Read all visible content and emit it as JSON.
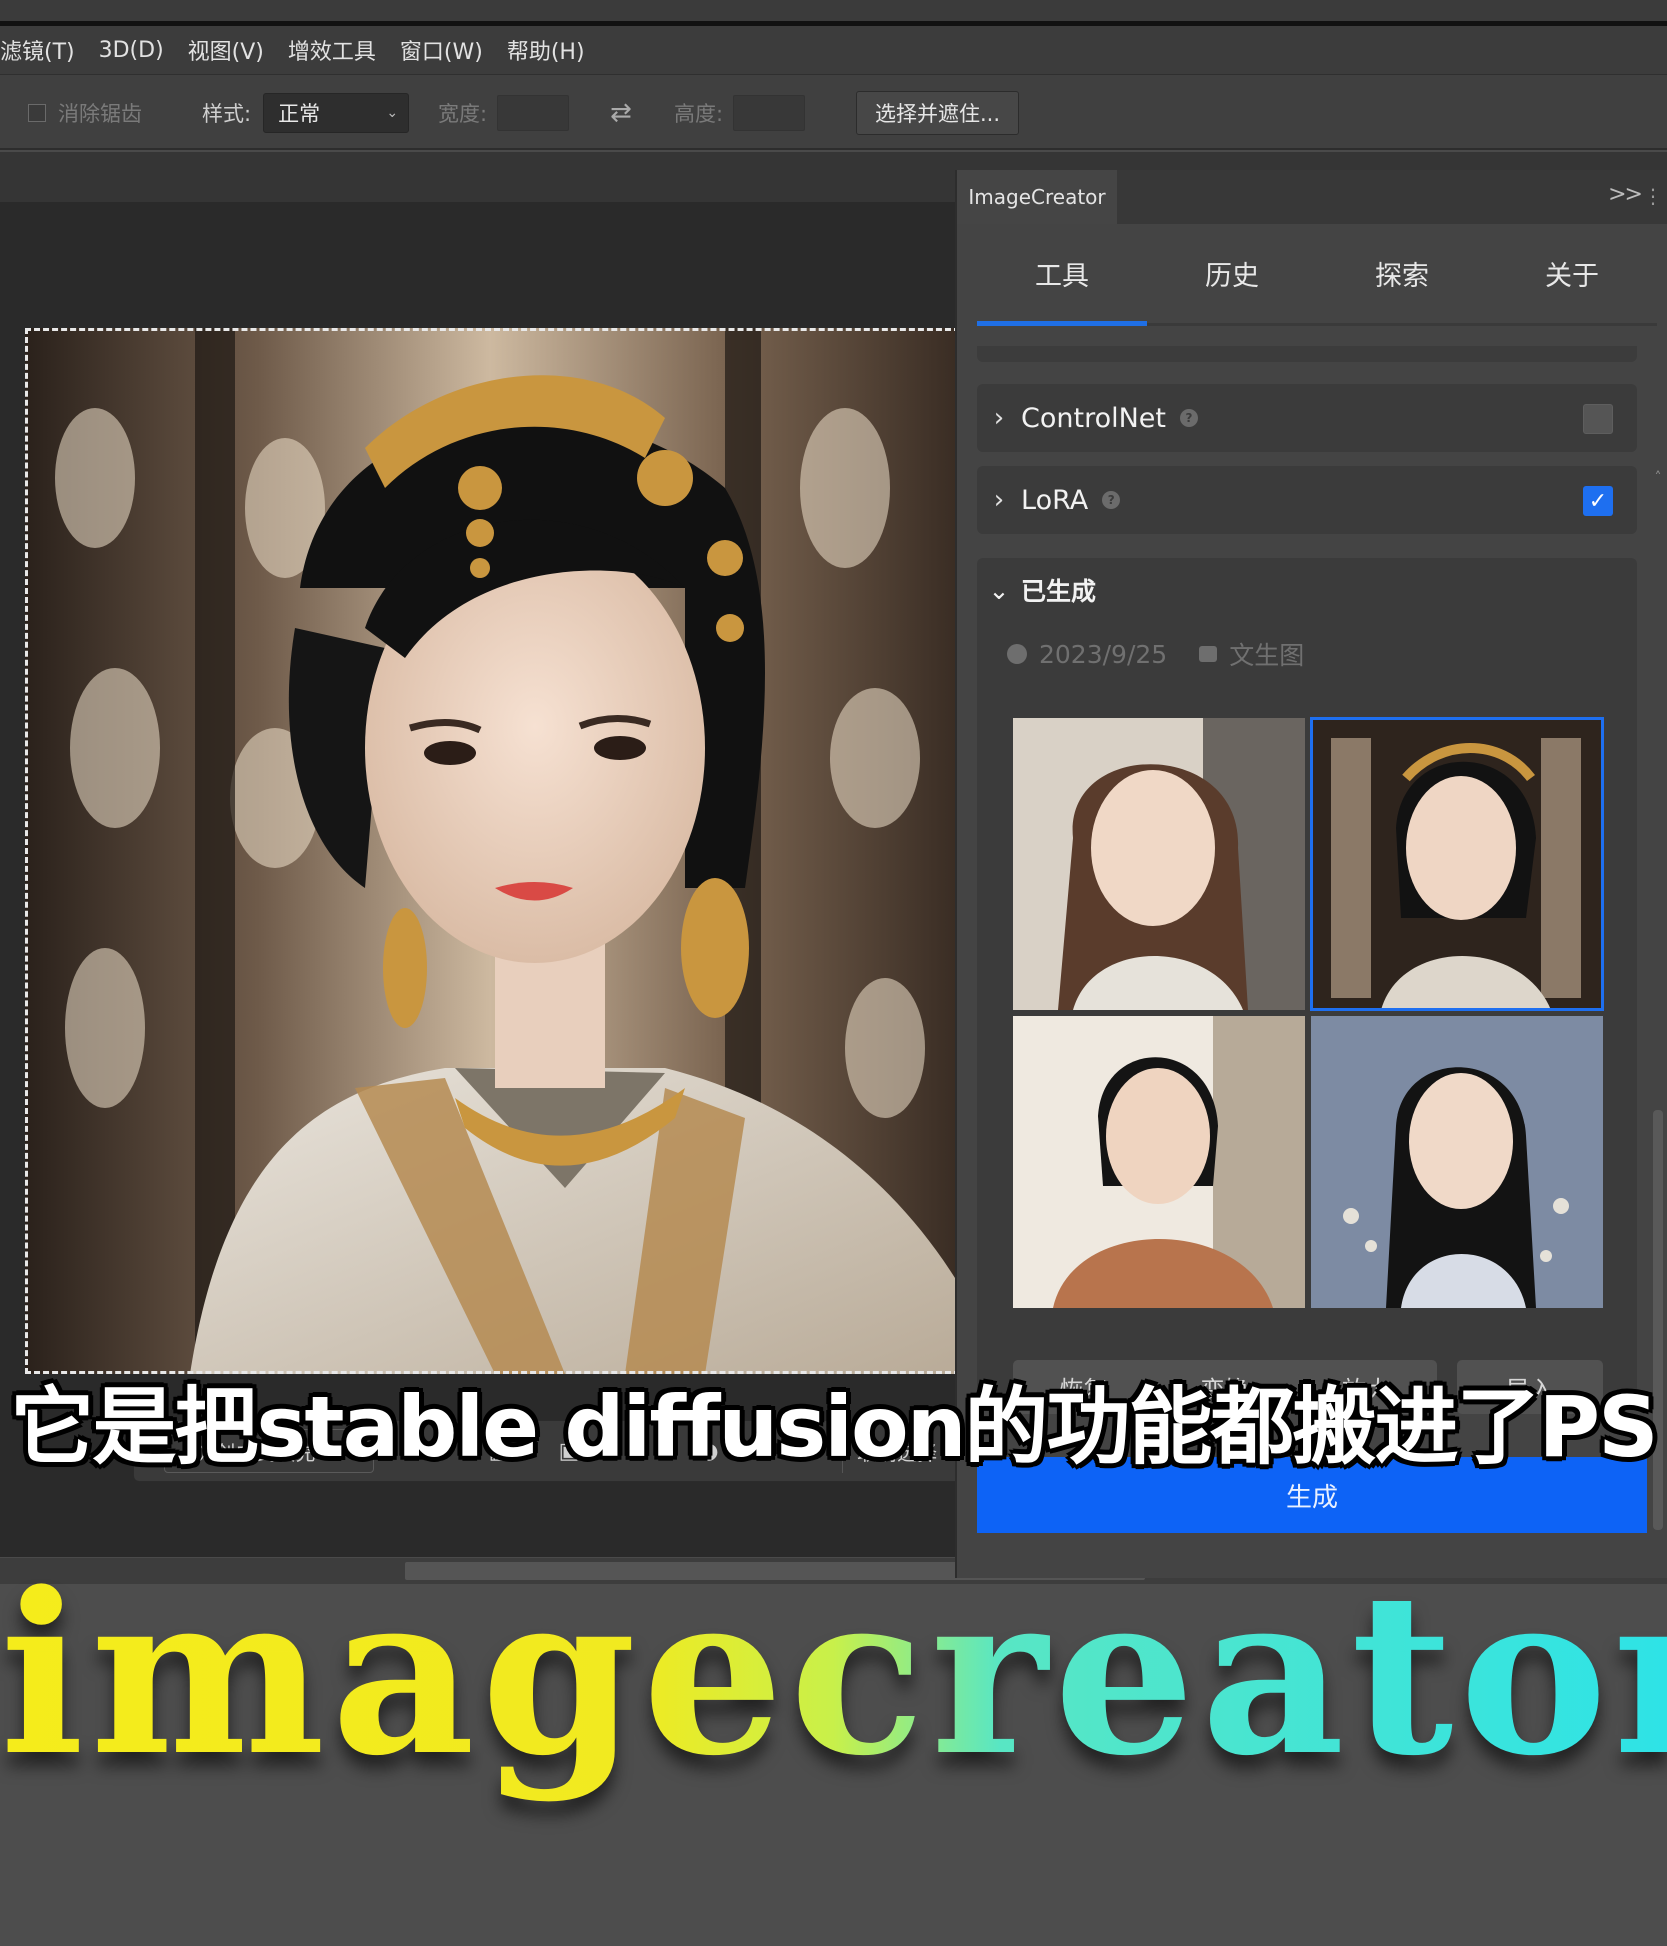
{
  "menubar": [
    "滤镜(T)",
    "3D(D)",
    "视图(V)",
    "增效工具",
    "窗口(W)",
    "帮助(H)"
  ],
  "options": {
    "anti_alias_label": "消除锯齿",
    "style_label": "样式:",
    "style_value": "正常",
    "width_label": "宽度:",
    "height_label": "高度:",
    "select_mask_button": "选择并遮住..."
  },
  "canvas": {
    "context_bar": {
      "generative_fill": "创成式填充",
      "deselect": "取消选择"
    }
  },
  "panel": {
    "tab_title": "ImageCreator",
    "collapse_glyph": ">>",
    "nav_tabs": [
      "工具",
      "历史",
      "探索",
      "关于"
    ],
    "active_tab_index": 0,
    "sections": [
      {
        "label": "ControlNet",
        "checked": false
      },
      {
        "label": "LoRA",
        "checked": true
      }
    ],
    "generated": {
      "title": "已生成",
      "date": "2023/9/25",
      "mode": "文生图",
      "selected_index": 1,
      "thumbnail_count": 4
    },
    "actions": [
      "恢复",
      "变换",
      "放大",
      "导入"
    ],
    "generate_button": "生成"
  },
  "overlay": {
    "subtitle": "它是把stable diffusion的功能都搬进了PS",
    "brand_text": "imagecreator"
  },
  "colors": {
    "accent": "#1e6ff0",
    "generate_button": "#0d63f6",
    "brand_gradient_start": "#f5ec1b",
    "brand_gradient_end": "#2ee3e6"
  }
}
